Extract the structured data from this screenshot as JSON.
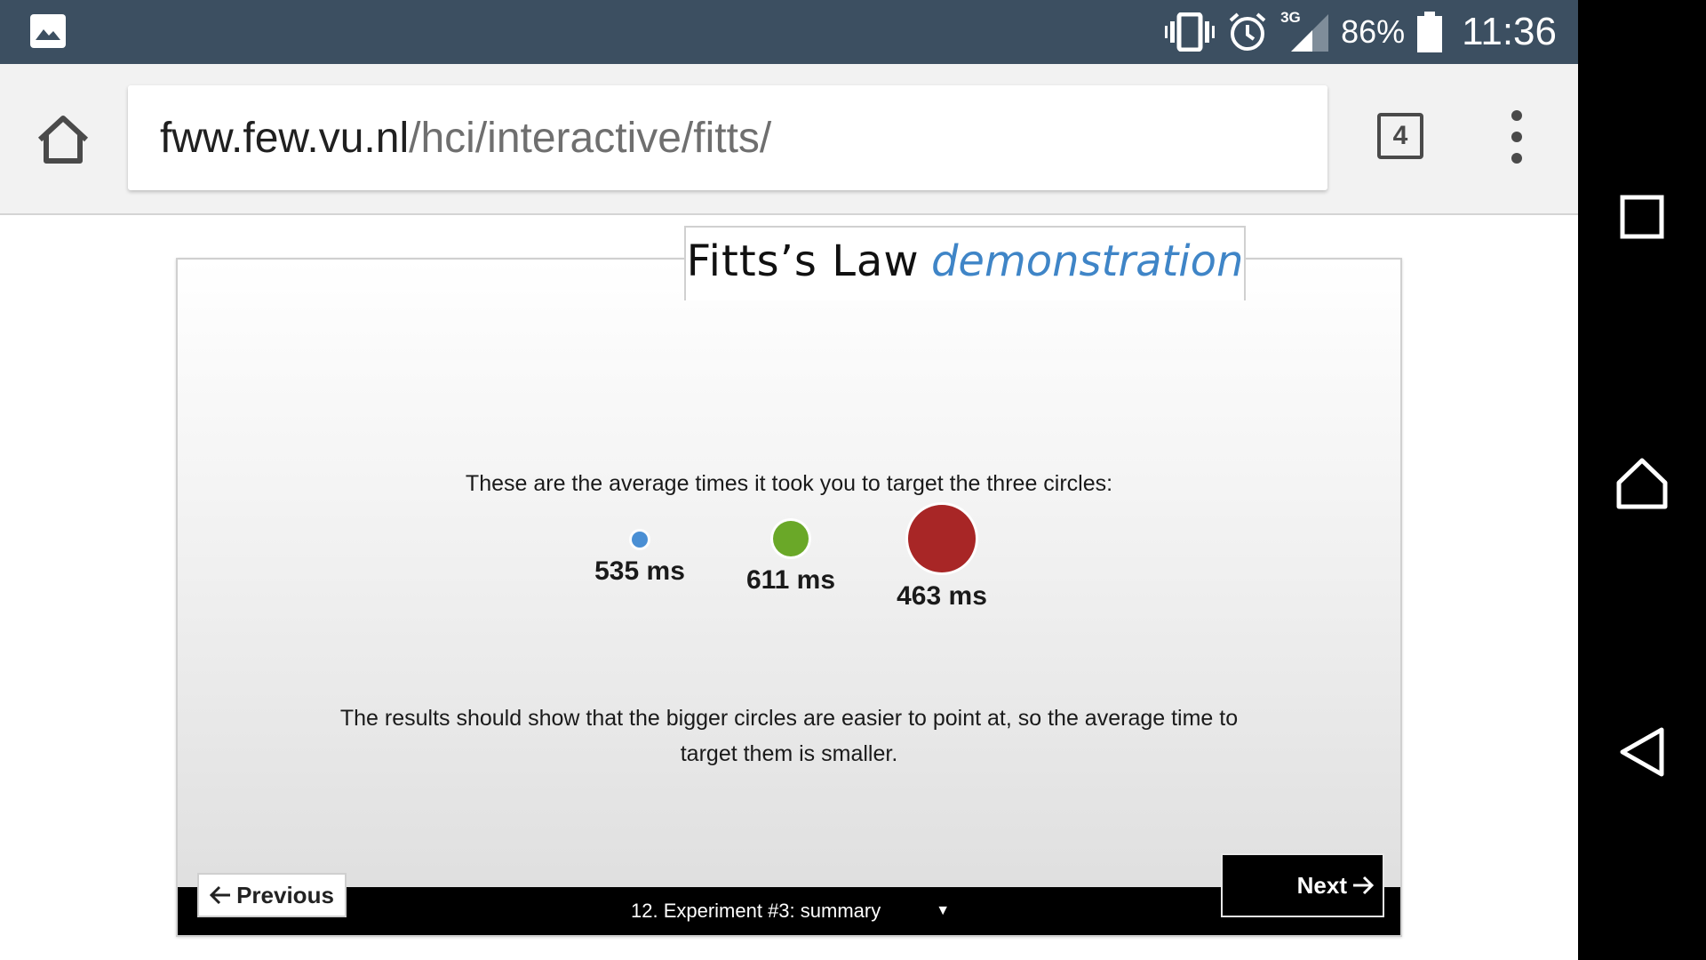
{
  "status_bar": {
    "network_label": "3G",
    "battery_percent": "86%",
    "time": "11:36",
    "icons": [
      "gallery-icon",
      "vibrate-icon",
      "alarm-icon",
      "signal-icon",
      "battery-icon"
    ]
  },
  "browser": {
    "url_domain": "fww.few.vu.nl",
    "url_path": "/hci/interactive/fitts/",
    "tab_count": "4"
  },
  "page": {
    "title_main": "Fitts’s Law",
    "title_accent": "demonstration",
    "intro": "These are the average times it took you to target the three circles:",
    "results": [
      {
        "label": "535 ms",
        "color": "#4a8fd4"
      },
      {
        "label": "611 ms",
        "color": "#6aa828"
      },
      {
        "label": "463 ms",
        "color": "#a82626"
      }
    ],
    "outro": "The results should show that the bigger circles are easier to point at, so the average time to target them is smaller.",
    "prev_label": "Previous",
    "next_label": "Next",
    "chapter_label": "12. Experiment #3: summary",
    "chapter_caret": "▼"
  },
  "colors": {
    "status_bar": "#3c4f61",
    "accent_title": "#3f85c7"
  }
}
